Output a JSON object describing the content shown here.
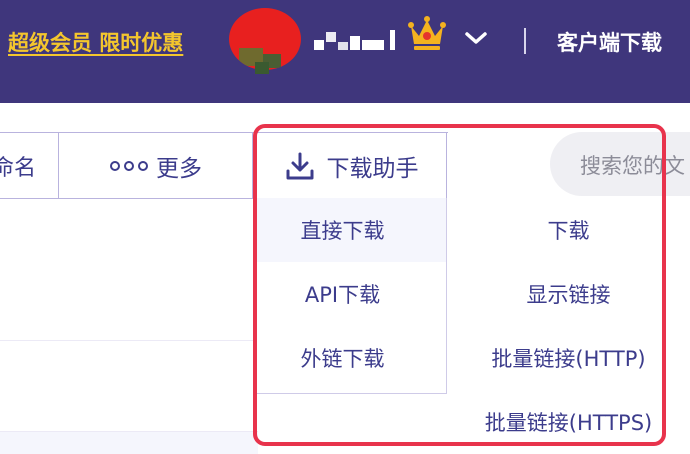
{
  "header": {
    "vip_link": "超级会员 限时优惠",
    "client_download": "客户端下载"
  },
  "toolbar": {
    "rename_partial": "命名",
    "more_label": "更多",
    "download_helper_label": "下载助手"
  },
  "search": {
    "placeholder_partial": "搜索您的文"
  },
  "download_menu": {
    "items": [
      "直接下载",
      "API下载",
      "外链下载"
    ]
  },
  "submenu": {
    "items": [
      "下载",
      "显示链接",
      "批量链接(HTTP)",
      "批量链接(HTTPS)"
    ]
  },
  "colors": {
    "header_bg": "#3f367c",
    "vip_gold": "#f4c62d",
    "text_purple": "#3c3c8c",
    "highlight_red": "#e8334c"
  },
  "icons": [
    "crown-icon",
    "chevron-down-icon",
    "more-dots-icon",
    "download-icon"
  ]
}
